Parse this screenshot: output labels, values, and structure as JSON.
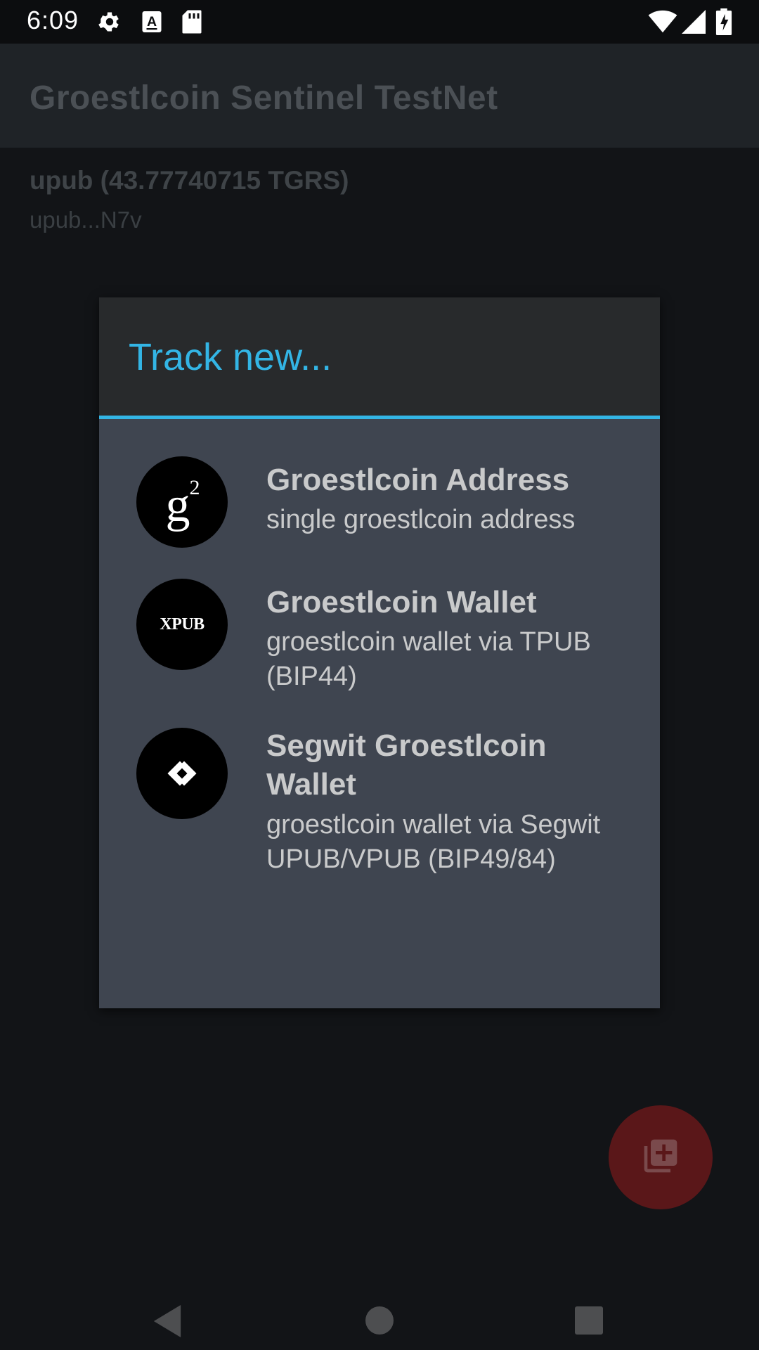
{
  "status_bar": {
    "time": "6:09",
    "icons": [
      "gear-icon",
      "a-icon",
      "sd-card-icon",
      "wifi-icon",
      "signal-icon",
      "battery-icon"
    ]
  },
  "app_bar": {
    "title": "Groestlcoin Sentinel TestNet"
  },
  "account": {
    "title": "upub (43.77740715 TGRS)",
    "subtitle": "upub...N7v"
  },
  "dialog": {
    "title": "Track new...",
    "options": [
      {
        "title": "Groestlcoin Address",
        "description": "single groestlcoin address",
        "icon": "groestlcoin-logo-icon"
      },
      {
        "title": "Groestlcoin Wallet",
        "description": "groestlcoin wallet via TPUB (BIP44)",
        "icon": "xpub-icon",
        "icon_label": "XPUB"
      },
      {
        "title": "Segwit Groestlcoin Wallet",
        "description": "groestlcoin wallet via Segwit UPUB/VPUB (BIP49/84)",
        "icon": "segwit-icon"
      }
    ]
  },
  "fab": {
    "icon": "add-to-library-icon"
  },
  "nav_bar": {
    "icons": [
      "back-icon",
      "home-icon",
      "recents-icon"
    ]
  },
  "colors": {
    "accent": "#33b5e5",
    "dialog_body": "#3f4550",
    "dialog_header": "#282a2c",
    "fab": "#5a1719"
  }
}
